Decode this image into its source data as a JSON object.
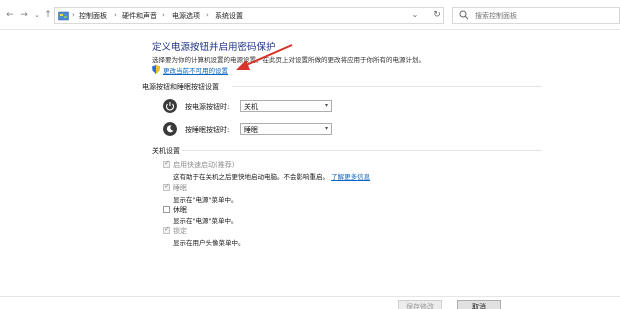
{
  "address": {
    "breadcrumbs": [
      "控制面板",
      "硬件和声音",
      "电源选项",
      "系统设置"
    ],
    "separator": ">"
  },
  "search": {
    "placeholder": "搜索控制面板"
  },
  "page": {
    "title": "定义电源按钮并启用密码保护",
    "description": "选择要为你的计算机设置的电源设置。在此页上对设置所做的更改将应用于你所有的电源计划。",
    "change_link": "更改当前不可用的设置"
  },
  "buttons_section": {
    "title": "电源按钮和睡眠按钮设置",
    "rows": [
      {
        "label": "按电源按钮时:",
        "value": "关机"
      },
      {
        "label": "按睡眠按钮时:",
        "value": "睡眠"
      }
    ]
  },
  "shutdown_section": {
    "title": "关机设置",
    "options": [
      {
        "label": "启用快速启动(推荐)",
        "checked": true,
        "disabled": true,
        "desc": "这有助于在关机之后更快地启动电脑。不会影响重启。",
        "link": "了解更多信息"
      },
      {
        "label": "睡眠",
        "checked": true,
        "disabled": true,
        "desc": "显示在\"电源\"菜单中。"
      },
      {
        "label": "休眠",
        "checked": false,
        "disabled": false,
        "desc": "显示在\"电源\"菜单中。"
      },
      {
        "label": "锁定",
        "checked": true,
        "disabled": true,
        "desc": "显示在用户头像菜单中。"
      }
    ]
  },
  "footer": {
    "save_label": "保存修改",
    "cancel_label": "取消"
  },
  "colors": {
    "title": "#1e3287",
    "link": "#0a66c2",
    "arrow": "#d9342b"
  }
}
